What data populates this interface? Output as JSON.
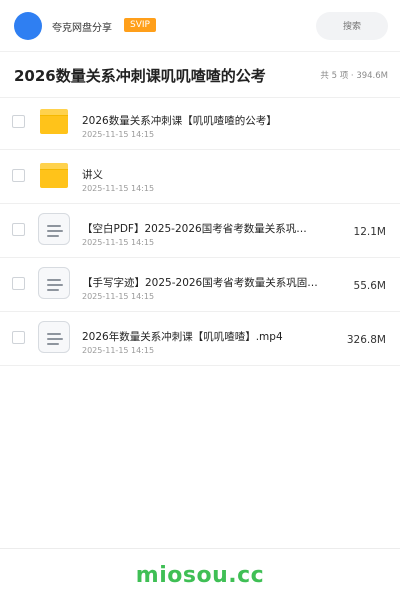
{
  "header": {
    "app_name": "夸克网盘分享",
    "badge": "SVIP",
    "search_placeholder": "搜索"
  },
  "folder": {
    "title": "2026数量关系冲刺课叽叽喳喳的公考",
    "summary": "共 5 项 · 394.6M"
  },
  "files": [
    {
      "type": "folder",
      "name": "2026数量关系冲刺课【叽叽喳喳的公考】",
      "date": "2025-11-15 14:15",
      "size": ""
    },
    {
      "type": "folder",
      "name": "讲义",
      "date": "2025-11-15 14:15",
      "size": ""
    },
    {
      "type": "file",
      "name": "【空白PDF】2025-2026国考省考数量关系巩…",
      "date": "2025-11-15 14:15",
      "size": "12.1M"
    },
    {
      "type": "file",
      "name": "【手写字迹】2025-2026国考省考数量关系巩固…",
      "date": "2025-11-15 14:15",
      "size": "55.6M"
    },
    {
      "type": "file",
      "name": "2026年数量关系冲刺课【叽叽喳喳】.mp4",
      "date": "2025-11-15 14:15",
      "size": "326.8M"
    }
  ],
  "footer": {
    "watermark": "miosou.cc"
  },
  "colors": {
    "accent": "#2f7ff2",
    "badge": "#ff9f1a",
    "folder": "#ffc31a",
    "watermark": "#3fbf55"
  },
  "icons": {
    "folder": "folder-icon",
    "file": "document-icon",
    "avatar": "avatar"
  }
}
